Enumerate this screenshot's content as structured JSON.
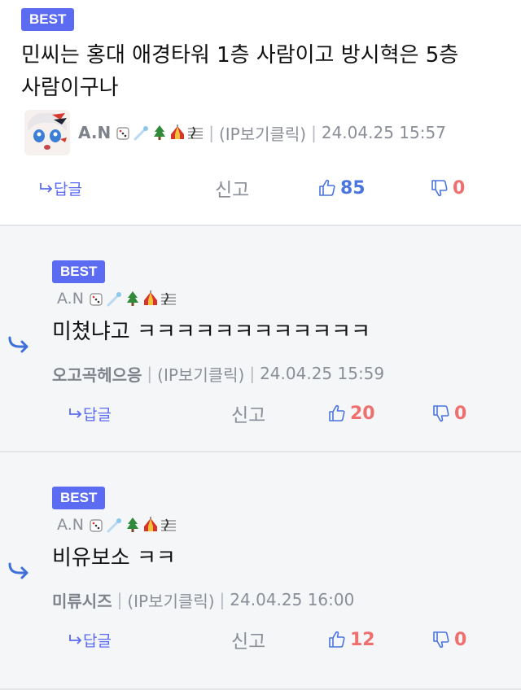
{
  "comments": [
    {
      "badge": "BEST",
      "text_line1": "민씨는 홍대 애경타워 1층 사람이고 방시혁은 5층",
      "text_line2": "사람이구나",
      "author": "A.N",
      "ip_label": "(IP보기클릭)",
      "datetime": "24.04.25 15:57",
      "reply_label": "답글",
      "report_label": "신고",
      "likes": "85",
      "dislikes": "0"
    },
    {
      "badge": "BEST",
      "parent_author": "A.N",
      "text": "미쳤냐고 ㅋㅋㅋㅋㅋㅋㅋㅋㅋㅋㅋㅋ",
      "author": "오고곡헤으응",
      "ip_label": "(IP보기클릭)",
      "datetime": "24.04.25 15:59",
      "reply_label": "답글",
      "report_label": "신고",
      "likes": "20",
      "dislikes": "0"
    },
    {
      "badge": "BEST",
      "parent_author": "A.N",
      "text": "비유보소 ㅋㅋ",
      "author": "미류시즈",
      "ip_label": "(IP보기클릭)",
      "datetime": "24.04.25 16:00",
      "reply_label": "답글",
      "report_label": "신고",
      "likes": "12",
      "dislikes": "0"
    }
  ],
  "separator": "|",
  "colors": {
    "badge": "#5b6bf2",
    "like_blue": "#4a74e0",
    "hot_red": "#ef6f6f",
    "meta_gray": "#8a8f98",
    "reply_bg": "#f5f6f8"
  },
  "icons": [
    "reply-arrow-icon",
    "thumbs-up-icon",
    "thumbs-down-icon",
    "dice-icon",
    "comet-icon",
    "tree-icon",
    "circus-tent-icon",
    "music-score-icon"
  ]
}
